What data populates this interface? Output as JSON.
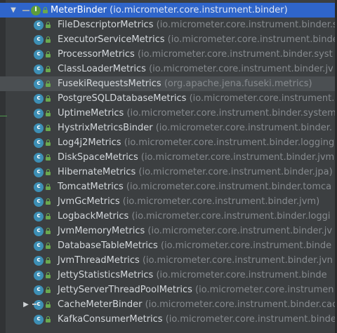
{
  "tree": {
    "root": {
      "name": "MeterBinder",
      "package": "(io.micrometer.core.instrument.binder)",
      "icon": "interface-icon"
    },
    "items": [
      {
        "name": "FileDescriptorMetrics",
        "package": "(io.micrometer.core.instrument.binder.sys"
      },
      {
        "name": "ExecutorServiceMetrics",
        "package": "(io.micrometer.core.instrument.binde"
      },
      {
        "name": "ProcessorMetrics",
        "package": "(io.micrometer.core.instrument.binder.syst"
      },
      {
        "name": "ClassLoaderMetrics",
        "package": "(io.micrometer.core.instrument.binder.jv"
      },
      {
        "name": "FusekiRequestsMetrics",
        "package": "(org.apache.jena.fuseki.metrics)"
      },
      {
        "name": "PostgreSQLDatabaseMetrics",
        "package": "(io.micrometer.core.instrument."
      },
      {
        "name": "UptimeMetrics",
        "package": "(io.micrometer.core.instrument.binder.system"
      },
      {
        "name": "HystrixMetricsBinder",
        "package": "(io.micrometer.core.instrument.binder."
      },
      {
        "name": "Log4j2Metrics",
        "package": "(io.micrometer.core.instrument.binder.logging"
      },
      {
        "name": "DiskSpaceMetrics",
        "package": "(io.micrometer.core.instrument.binder.jvm"
      },
      {
        "name": "HibernateMetrics",
        "package": "(io.micrometer.core.instrument.binder.jpa)"
      },
      {
        "name": "TomcatMetrics",
        "package": "(io.micrometer.core.instrument.binder.tomca"
      },
      {
        "name": "JvmGcMetrics",
        "package": "(io.micrometer.core.instrument.binder.jvm)"
      },
      {
        "name": "LogbackMetrics",
        "package": "(io.micrometer.core.instrument.binder.loggi"
      },
      {
        "name": "JvmMemoryMetrics",
        "package": "(io.micrometer.core.instrument.binder.jv"
      },
      {
        "name": "DatabaseTableMetrics",
        "package": "(io.micrometer.core.instrument.binde"
      },
      {
        "name": "JvmThreadMetrics",
        "package": "(io.micrometer.core.instrument.binder.jvn"
      },
      {
        "name": "JettyStatisticsMetrics",
        "package": "(io.micrometer.core.instrument.binde"
      },
      {
        "name": "JettyServerThreadPoolMetrics",
        "package": "(io.micrometer.core.instrumen"
      },
      {
        "name": "CacheMeterBinder",
        "package": "(io.micrometer.core.instrument.binder.cac"
      },
      {
        "name": "KafkaConsumerMetrics",
        "package": "(io.micrometer.core.instrument.binde"
      }
    ],
    "class_icon_letter": "c",
    "interface_icon_letter": "I",
    "expanded_arrow": "▼",
    "collapsed_arrow": "▶"
  }
}
